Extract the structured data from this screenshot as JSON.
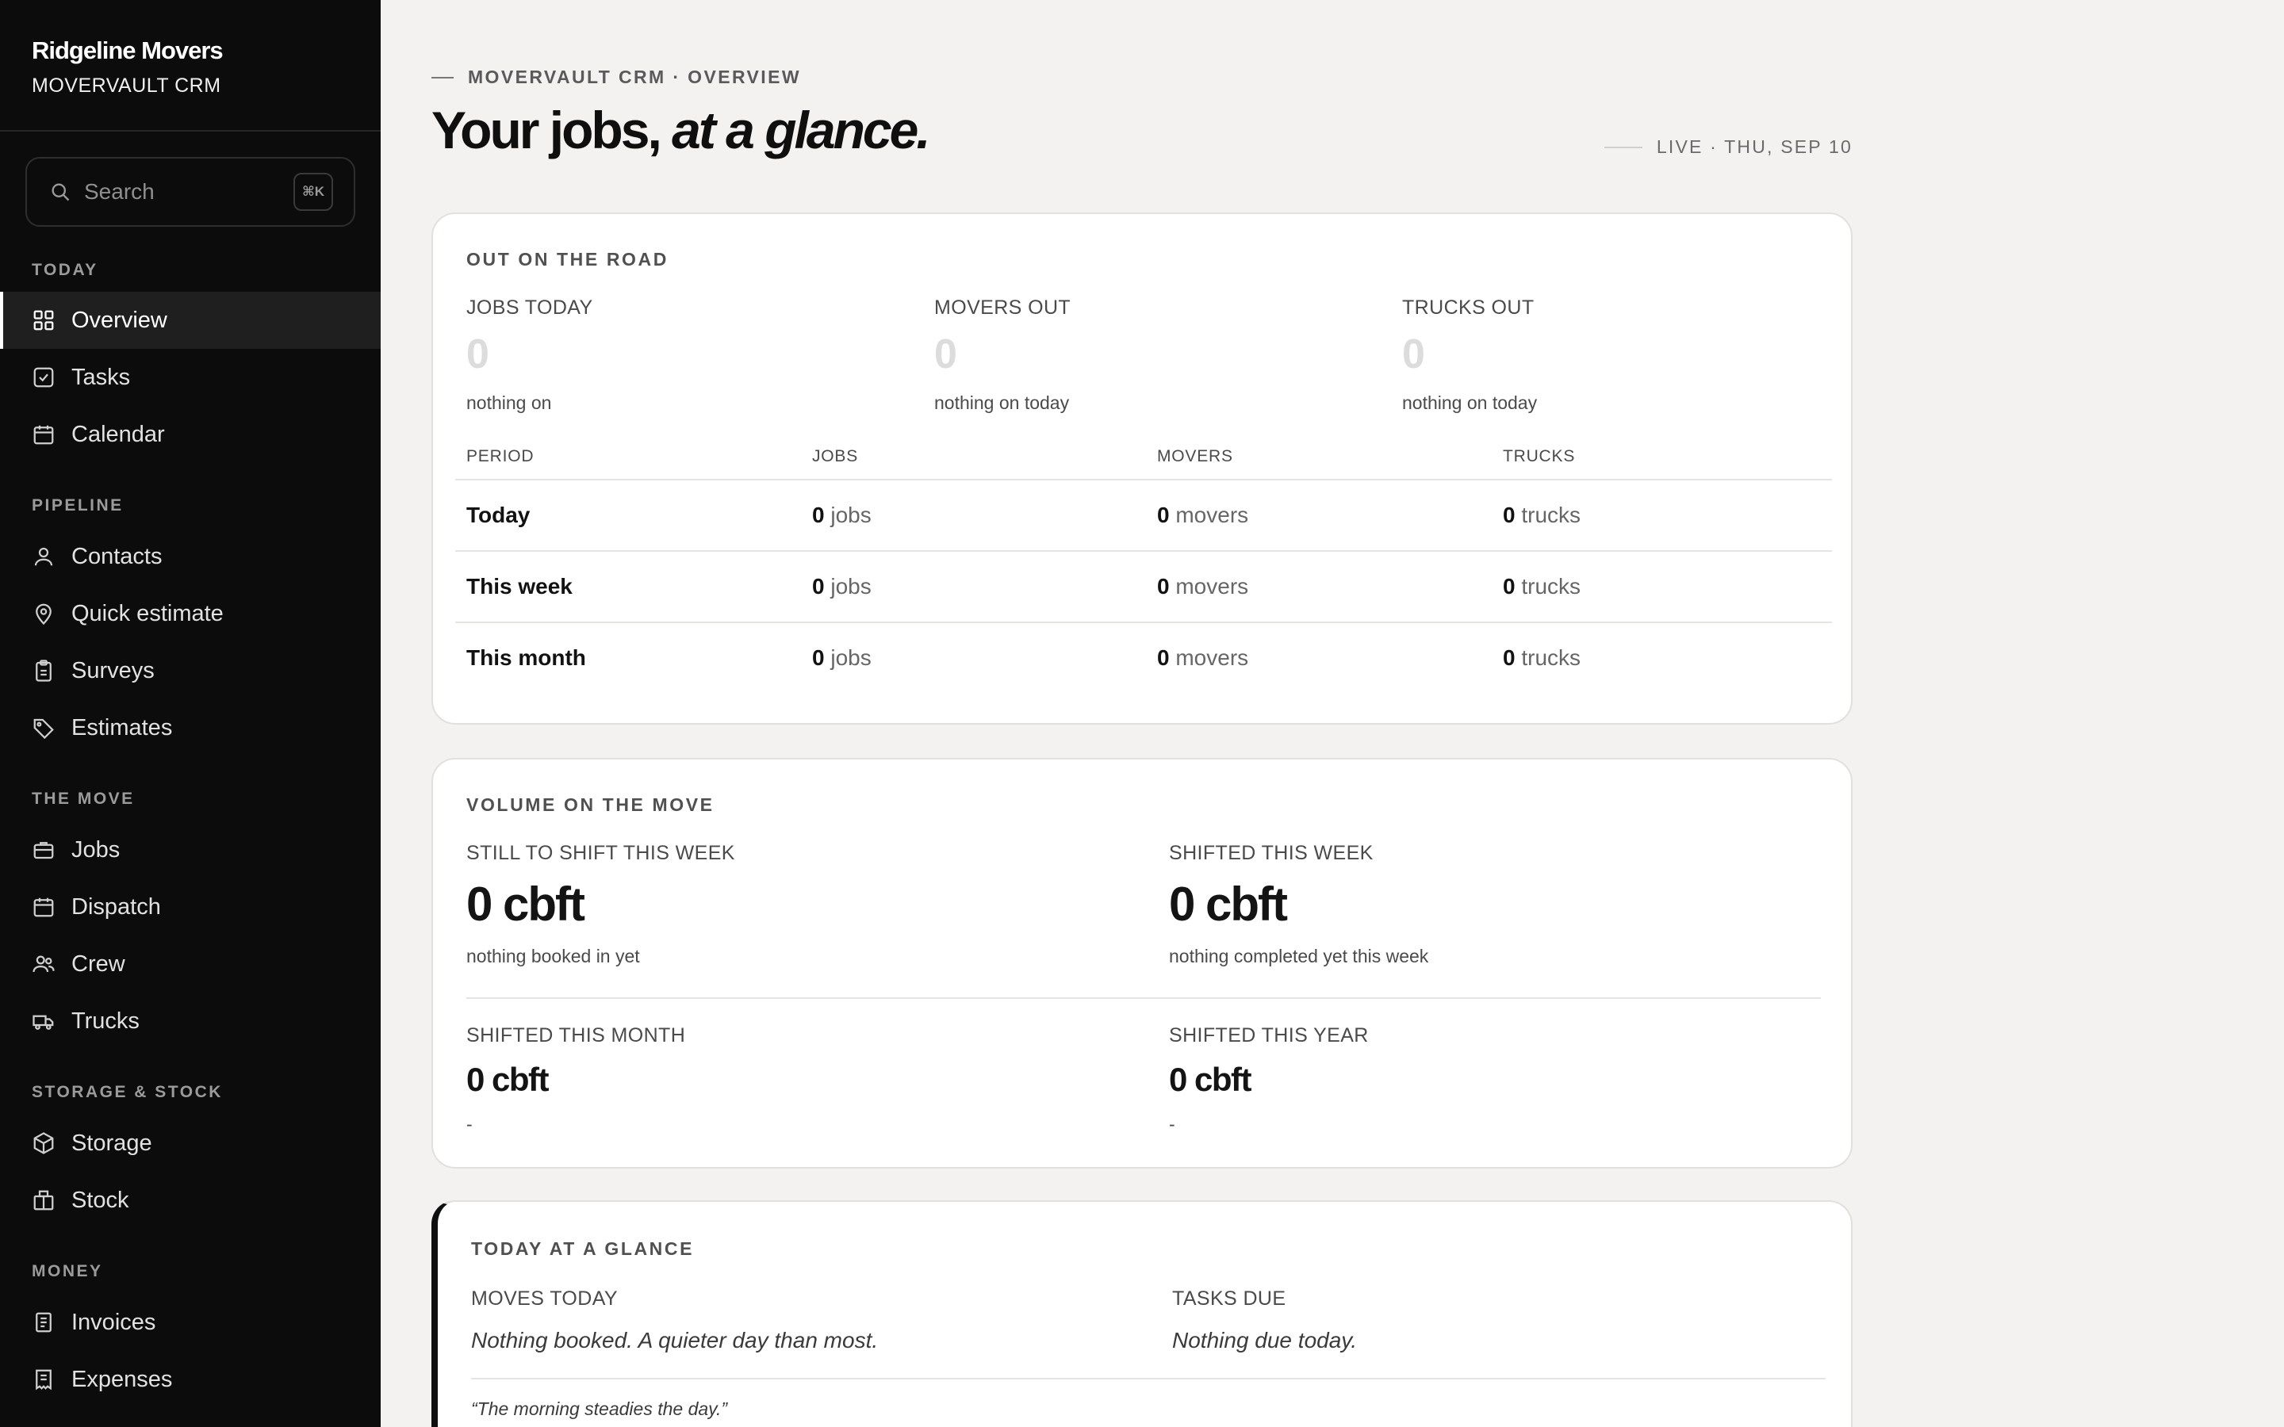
{
  "brand": {
    "name": "Ridgeline Movers",
    "subtitle": "MOVERVAULT CRM"
  },
  "search": {
    "placeholder": "Search",
    "shortcut": "⌘K"
  },
  "sidebar": {
    "sections": [
      {
        "title": "TODAY",
        "items": [
          {
            "label": "Overview",
            "icon": "grid-icon",
            "active": true
          },
          {
            "label": "Tasks",
            "icon": "checkbox-icon"
          },
          {
            "label": "Calendar",
            "icon": "calendar-icon"
          }
        ]
      },
      {
        "title": "PIPELINE",
        "items": [
          {
            "label": "Contacts",
            "icon": "person-icon"
          },
          {
            "label": "Quick estimate",
            "icon": "map-pin-icon"
          },
          {
            "label": "Surveys",
            "icon": "clipboard-icon"
          },
          {
            "label": "Estimates",
            "icon": "tag-icon"
          }
        ]
      },
      {
        "title": "THE MOVE",
        "items": [
          {
            "label": "Jobs",
            "icon": "briefcase-icon"
          },
          {
            "label": "Dispatch",
            "icon": "calendar-icon"
          },
          {
            "label": "Crew",
            "icon": "users-icon"
          },
          {
            "label": "Trucks",
            "icon": "truck-icon"
          }
        ]
      },
      {
        "title": "STORAGE & STOCK",
        "items": [
          {
            "label": "Storage",
            "icon": "box-icon"
          },
          {
            "label": "Stock",
            "icon": "package-icon"
          }
        ]
      },
      {
        "title": "MONEY",
        "items": [
          {
            "label": "Invoices",
            "icon": "document-icon"
          },
          {
            "label": "Expenses",
            "icon": "receipt-icon"
          }
        ]
      }
    ]
  },
  "header": {
    "eyebrow": "MOVERVAULT CRM · OVERVIEW",
    "title_main": "Your jobs,",
    "title_italic": "at a glance.",
    "live": "LIVE · THU, SEP 10"
  },
  "road": {
    "title": "OUT ON THE ROAD",
    "stats": [
      {
        "label": "JOBS TODAY",
        "value": "0",
        "note": "nothing on"
      },
      {
        "label": "MOVERS OUT",
        "value": "0",
        "note": "nothing on today"
      },
      {
        "label": "TRUCKS OUT",
        "value": "0",
        "note": "nothing on today"
      }
    ],
    "table": {
      "headers": [
        "PERIOD",
        "JOBS",
        "MOVERS",
        "TRUCKS"
      ],
      "rows": [
        {
          "period": "Today",
          "jobs": "0",
          "movers": "0",
          "trucks": "0"
        },
        {
          "period": "This week",
          "jobs": "0",
          "movers": "0",
          "trucks": "0"
        },
        {
          "period": "This month",
          "jobs": "0",
          "movers": "0",
          "trucks": "0"
        }
      ],
      "units": {
        "jobs": "jobs",
        "movers": "movers",
        "trucks": "trucks"
      }
    }
  },
  "volume": {
    "title": "VOLUME ON THE MOVE",
    "items": [
      {
        "label": "STILL TO SHIFT THIS WEEK",
        "value": "0 cbft",
        "note": "nothing booked in yet"
      },
      {
        "label": "SHIFTED THIS WEEK",
        "value": "0 cbft",
        "note": "nothing completed yet this week"
      },
      {
        "label": "SHIFTED THIS MONTH",
        "value": "0 cbft",
        "note": "-"
      },
      {
        "label": "SHIFTED THIS YEAR",
        "value": "0 cbft",
        "note": "-"
      }
    ]
  },
  "glance": {
    "title": "TODAY AT A GLANCE",
    "moves_label": "MOVES TODAY",
    "moves_text": "Nothing booked. A quieter day than most.",
    "tasks_label": "TASKS DUE",
    "tasks_text": "Nothing due today.",
    "quote": "“The morning steadies the day.”"
  }
}
